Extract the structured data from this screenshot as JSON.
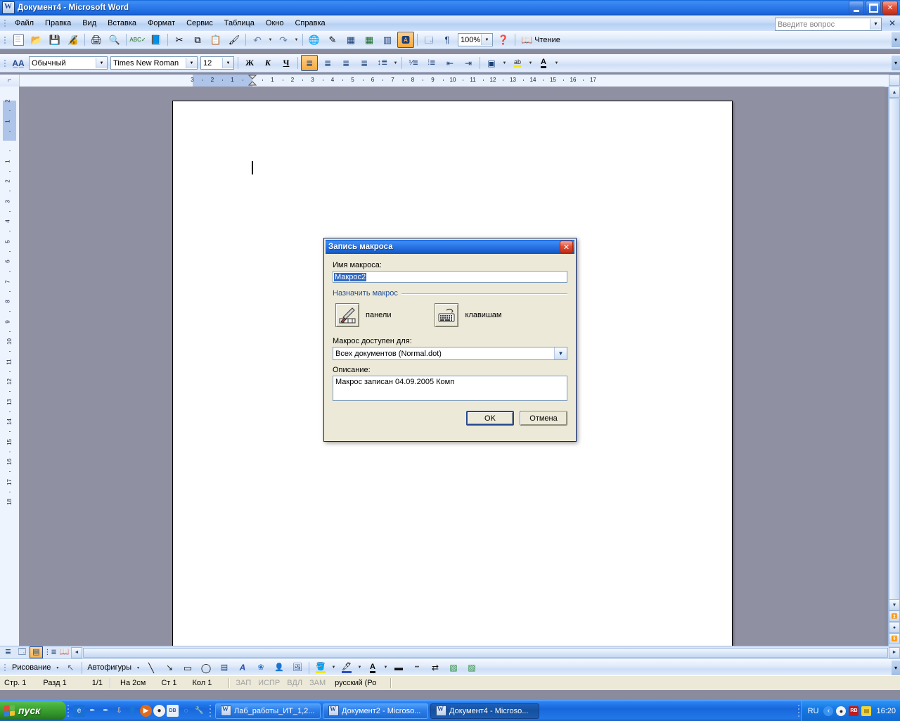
{
  "window": {
    "title": "Документ4 - Microsoft Word",
    "app_icon": "word-document-icon",
    "minimize": "–",
    "maximize": "❐",
    "close": "✕"
  },
  "menubar": {
    "items": [
      {
        "label": "Файл",
        "accel": "Ф"
      },
      {
        "label": "Правка",
        "accel": "П"
      },
      {
        "label": "Вид",
        "accel": "и"
      },
      {
        "label": "Вставка",
        "accel": "а"
      },
      {
        "label": "Формат",
        "accel": "м"
      },
      {
        "label": "Сервис",
        "accel": "е"
      },
      {
        "label": "Таблица",
        "accel": "Т"
      },
      {
        "label": "Окно",
        "accel": "О"
      },
      {
        "label": "Справка",
        "accel": "С"
      }
    ],
    "ask_placeholder": "Введите вопрос",
    "ask_close": "✕"
  },
  "standard_toolbar": {
    "buttons": [
      {
        "name": "new-document-icon",
        "glyph": "📄"
      },
      {
        "name": "open-icon",
        "glyph": "📂"
      },
      {
        "name": "save-icon",
        "glyph": "💾"
      },
      {
        "name": "permission-icon",
        "glyph": "🔏"
      },
      {
        "name": "print-icon",
        "glyph": "🖨"
      },
      {
        "name": "print-preview-icon",
        "glyph": "🔍"
      },
      {
        "name": "spelling-check-icon",
        "glyph": "ABC"
      },
      {
        "name": "research-icon",
        "glyph": "📘"
      },
      {
        "name": "cut-icon",
        "glyph": "✂"
      },
      {
        "name": "copy-icon",
        "glyph": "⧉"
      },
      {
        "name": "paste-icon",
        "glyph": "📋"
      },
      {
        "name": "format-painter-icon",
        "glyph": "🖌"
      },
      {
        "name": "undo-icon",
        "glyph": "↶"
      },
      {
        "name": "redo-icon",
        "glyph": "↷"
      },
      {
        "name": "hyperlink-icon",
        "glyph": "🌐"
      },
      {
        "name": "tables-borders-icon",
        "glyph": "✎"
      },
      {
        "name": "insert-table-icon",
        "glyph": "▦"
      },
      {
        "name": "insert-excel-sheet-icon",
        "glyph": "▤"
      },
      {
        "name": "columns-icon",
        "glyph": "▥"
      },
      {
        "name": "drawing-icon",
        "glyph": "A"
      },
      {
        "name": "document-map-icon",
        "glyph": "🗺"
      },
      {
        "name": "show-formatting-icon",
        "glyph": "¶"
      },
      {
        "name": "help-icon",
        "glyph": "?"
      },
      {
        "name": "reading-layout-icon",
        "glyph": "📖"
      }
    ],
    "zoom_value": "100%",
    "reading_label": "Чтение",
    "reading_accel": "Ч",
    "overflow": "▾"
  },
  "formatting_toolbar": {
    "styles_icon": "styles-and-formatting-icon",
    "style_value": "Обычный",
    "font_value": "Times New Roman",
    "size_value": "12",
    "bold": "Ж",
    "italic": "К",
    "underline": "Ч",
    "buttons": [
      {
        "name": "align-left-icon",
        "glyph": "≡"
      },
      {
        "name": "align-center-icon",
        "glyph": "≡"
      },
      {
        "name": "align-right-icon",
        "glyph": "≡"
      },
      {
        "name": "justify-icon",
        "glyph": "≡"
      },
      {
        "name": "line-spacing-icon",
        "glyph": "↕"
      },
      {
        "name": "numbered-list-icon",
        "glyph": "1≡"
      },
      {
        "name": "bulleted-list-icon",
        "glyph": "•≡"
      },
      {
        "name": "decrease-indent-icon",
        "glyph": "⇤"
      },
      {
        "name": "increase-indent-icon",
        "glyph": "⇥"
      },
      {
        "name": "borders-icon",
        "glyph": "▢"
      },
      {
        "name": "highlight-icon",
        "glyph": "ab"
      },
      {
        "name": "font-color-icon",
        "glyph": "A"
      }
    ],
    "overflow": "▾"
  },
  "ruler": {
    "corner_icon": "tab-stop-left-icon",
    "horizontal_margin_labels": [
      "3",
      "2",
      "1"
    ],
    "horizontal_page_labels": [
      "1",
      "2",
      "3",
      "4",
      "5",
      "6",
      "7",
      "8",
      "9",
      "10",
      "11",
      "12",
      "13",
      "14",
      "15",
      "16",
      "17"
    ],
    "vertical_margin_labels": [
      "2",
      "1"
    ],
    "vertical_page_labels": [
      "1",
      "2",
      "3",
      "4",
      "5",
      "6",
      "7",
      "8",
      "9",
      "10",
      "11",
      "12",
      "13",
      "14",
      "15",
      "16",
      "17",
      "18"
    ]
  },
  "dialog": {
    "title": "Запись макроса",
    "close_glyph": "✕",
    "name_label": "Имя макроса:",
    "name_accel": "И",
    "name_value": "Макрос2",
    "assign_group_label": "Назначить макрос",
    "assign_toolbars_label": "панели",
    "assign_toolbars_accel": "п",
    "assign_toolbars_icon": "hammer-toolbar-icon",
    "assign_keyboard_label": "клавишам",
    "assign_keyboard_accel": "к",
    "assign_keyboard_icon": "keyboard-icon",
    "store_label": "Макрос доступен для:",
    "store_accel": "М",
    "store_value": "Всех документов (Normal.dot)",
    "store_arrow": "▼",
    "description_label": "Описание:",
    "description_accel": "О",
    "description_value": "Макрос записан 04.09.2005 Комп",
    "ok_label": "OK",
    "cancel_label": "Отмена"
  },
  "view_buttons": [
    {
      "name": "normal-view-icon",
      "glyph": "≣",
      "selected": false
    },
    {
      "name": "web-layout-view-icon",
      "glyph": "🗔",
      "selected": false
    },
    {
      "name": "print-layout-view-icon",
      "glyph": "▤",
      "selected": true
    },
    {
      "name": "outline-view-icon",
      "glyph": "⋮≡",
      "selected": false
    },
    {
      "name": "reading-layout-view-icon",
      "glyph": "📖",
      "selected": false
    }
  ],
  "drawing_toolbar": {
    "menu_label": "Рисование",
    "menu_accel": "Р",
    "menu_arrow": "▾",
    "autoshapes_label": "Автофигуры",
    "autoshapes_accel": "г",
    "autoshapes_arrow": "▾",
    "buttons": [
      {
        "name": "select-objects-icon",
        "glyph": "↖"
      },
      {
        "name": "line-icon",
        "glyph": "╲"
      },
      {
        "name": "arrow-icon",
        "glyph": "↘"
      },
      {
        "name": "rectangle-icon",
        "glyph": "▭"
      },
      {
        "name": "oval-icon",
        "glyph": "◯"
      },
      {
        "name": "text-box-icon",
        "glyph": "▤"
      },
      {
        "name": "wordart-icon",
        "glyph": "A"
      },
      {
        "name": "diagram-icon",
        "glyph": "❀"
      },
      {
        "name": "clip-art-icon",
        "glyph": "👤"
      },
      {
        "name": "picture-icon",
        "glyph": "🖼"
      },
      {
        "name": "fill-color-icon",
        "glyph": "🪣"
      },
      {
        "name": "line-color-icon",
        "glyph": "🖊"
      },
      {
        "name": "font-color-icon",
        "glyph": "A"
      },
      {
        "name": "line-style-icon",
        "glyph": "▬"
      },
      {
        "name": "dash-style-icon",
        "glyph": "┅"
      },
      {
        "name": "arrow-style-icon",
        "glyph": "⇄"
      },
      {
        "name": "shadow-style-icon",
        "glyph": "▧"
      },
      {
        "name": "3d-style-icon",
        "glyph": "▨"
      }
    ],
    "overflow": "▾"
  },
  "statusbar": {
    "page": "Стр. 1",
    "section": "Разд 1",
    "pages": "1/1",
    "at": "На 2см",
    "line": "Ст 1",
    "column": "Кол 1",
    "rec": "ЗАП",
    "trk": "ИСПР",
    "ext": "ВДЛ",
    "ovr": "ЗАМ",
    "language": "русский (Ро"
  },
  "taskbar": {
    "start_label": "пуск",
    "start_icon": "windows-flag-icon",
    "quick_launch": [
      {
        "name": "internet-explorer-icon",
        "glyph": "e",
        "color": "#1a6fd4"
      },
      {
        "name": "show-desktop-icon",
        "glyph": "✒",
        "color": "#7fa8d8"
      },
      {
        "name": "media-link-icon",
        "glyph": "✒",
        "color": "#7fa8d8"
      },
      {
        "name": "download-manager-icon",
        "glyph": "⇩",
        "color": "#3d79c8"
      },
      {
        "name": "user-icon",
        "glyph": "👤",
        "color": "#4a86cf"
      },
      {
        "name": "media-player-icon",
        "glyph": "▶",
        "color": "#e06a1c"
      },
      {
        "name": "panda-antivirus-icon",
        "glyph": "🐼",
        "color": "#e8e8e8"
      },
      {
        "name": "db-tool-icon",
        "glyph": "DB",
        "color": "#4a86cf"
      },
      {
        "name": "search-icon",
        "glyph": "◌",
        "color": "#3d79c8"
      },
      {
        "name": "tools-icon",
        "glyph": "🔧",
        "color": "#d8a23c"
      }
    ],
    "tasks": [
      {
        "label": "Лаб_работы_ИТ_1,2...",
        "active": false
      },
      {
        "label": "Документ2 - Microso...",
        "active": false
      },
      {
        "label": "Документ4 - Microso...",
        "active": true
      }
    ],
    "tray": {
      "language": "RU",
      "icons": [
        {
          "name": "volume-icon",
          "glyph": "🔊",
          "color": "#2d7fe0"
        },
        {
          "name": "panda-tray-icon",
          "glyph": "🐼",
          "color": "#f2f2f2"
        },
        {
          "name": "rb-tray-icon",
          "glyph": "RB",
          "color": "#c41a1a"
        },
        {
          "name": "notes-tray-icon",
          "glyph": "📒",
          "color": "#f0d43a"
        }
      ],
      "clock": "16:20"
    }
  },
  "colors": {
    "title_blue": "#0a62d4",
    "desktop": "#8b8b9e",
    "dialog_face": "#ece9d8",
    "selection_blue": "#316ac5",
    "accent_orange": "#f5a93f"
  }
}
